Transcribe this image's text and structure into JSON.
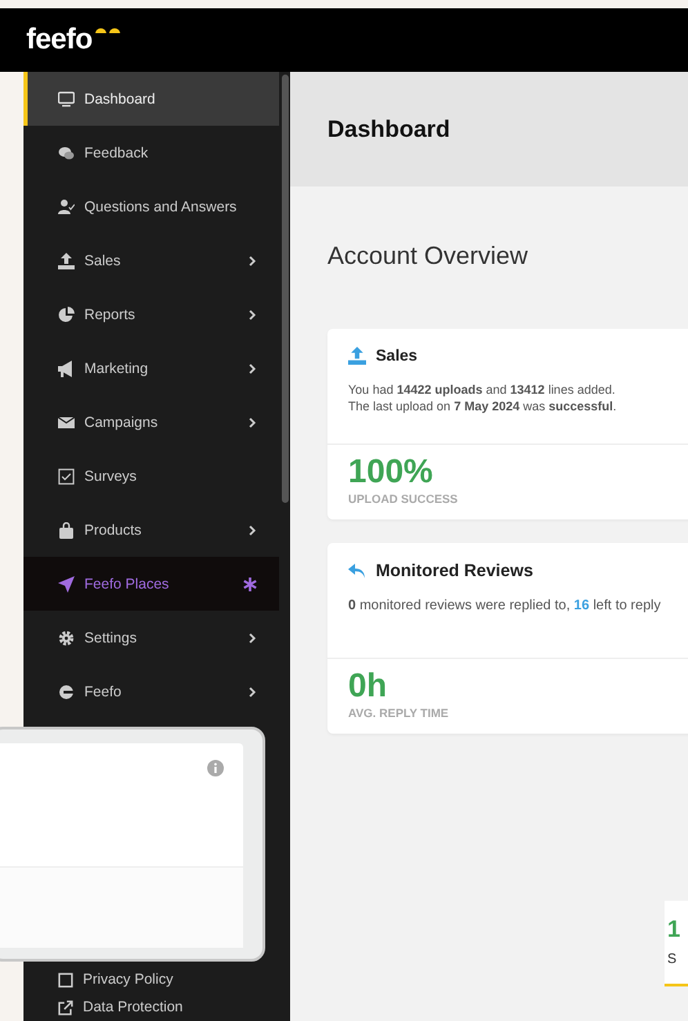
{
  "logo": "feefo",
  "sidebar": {
    "items": [
      {
        "label": "Dashboard",
        "submenu": false,
        "selected": true,
        "new": false
      },
      {
        "label": "Feedback",
        "submenu": false,
        "selected": false,
        "new": false
      },
      {
        "label": "Questions and Answers",
        "submenu": false,
        "selected": false,
        "new": false
      },
      {
        "label": "Sales",
        "submenu": true,
        "selected": false,
        "new": false
      },
      {
        "label": "Reports",
        "submenu": true,
        "selected": false,
        "new": false
      },
      {
        "label": "Marketing",
        "submenu": true,
        "selected": false,
        "new": false
      },
      {
        "label": "Campaigns",
        "submenu": true,
        "selected": false,
        "new": false
      },
      {
        "label": "Surveys",
        "submenu": false,
        "selected": false,
        "new": false
      },
      {
        "label": "Products",
        "submenu": true,
        "selected": false,
        "new": false
      },
      {
        "label": "Feefo Places",
        "submenu": false,
        "selected": false,
        "new": true
      },
      {
        "label": "Settings",
        "submenu": true,
        "selected": false,
        "new": false
      },
      {
        "label": "Feefo",
        "submenu": true,
        "selected": false,
        "new": false
      }
    ],
    "footer_items": [
      {
        "label": "Privacy Policy"
      },
      {
        "label": "Data Protection"
      }
    ]
  },
  "page_title": "Dashboard",
  "section_title": "Account Overview",
  "cards": [
    {
      "title": "Sales",
      "text": [
        "You had **14422 uploads** and **13412** lines added.",
        "The last upload on **7 May 2024** was **successful**."
      ],
      "stat": "100%",
      "stat_label": "UPLOAD SUCCESS"
    },
    {
      "title": "Monitored Reviews",
      "segments": [
        {
          "text": "0",
          "kind": "bold"
        },
        {
          "text": " monitored reviews were replied to, ",
          "kind": "plain"
        },
        {
          "text": "16",
          "kind": "link"
        },
        {
          "text": " left to reply",
          "kind": "plain"
        }
      ],
      "stat": "0h",
      "stat_label": "AVG. REPLY TIME"
    }
  ],
  "corner_card": {
    "stat": "1",
    "label": "S"
  }
}
